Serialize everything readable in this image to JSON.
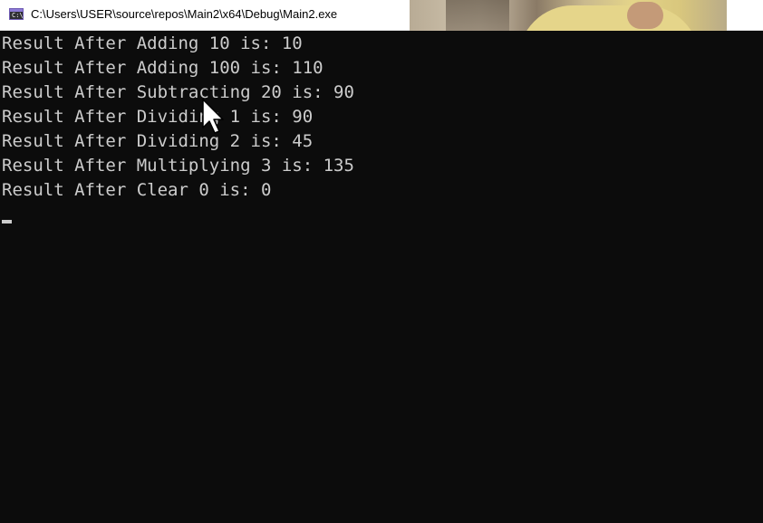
{
  "window": {
    "title": "C:\\Users\\USER\\source\\repos\\Main2\\x64\\Debug\\Main2.exe",
    "icon": "console-app-icon",
    "icon_glyph": "C:\\"
  },
  "console": {
    "lines": [
      "Result After Adding 10 is: 10",
      "Result After Adding 100 is: 110",
      "Result After Subtracting 20 is: 90",
      "Result After Dividing 1 is: 90",
      "Result After Dividing 2 is: 45",
      "Result After Multiplying 3 is: 135",
      "Result After Clear 0 is: 0"
    ],
    "background": "#0c0c0c",
    "foreground": "#cccccc"
  },
  "overlays": {
    "mouse_pointer": "arrow-cursor-icon",
    "webcam": "webcam-feed"
  }
}
